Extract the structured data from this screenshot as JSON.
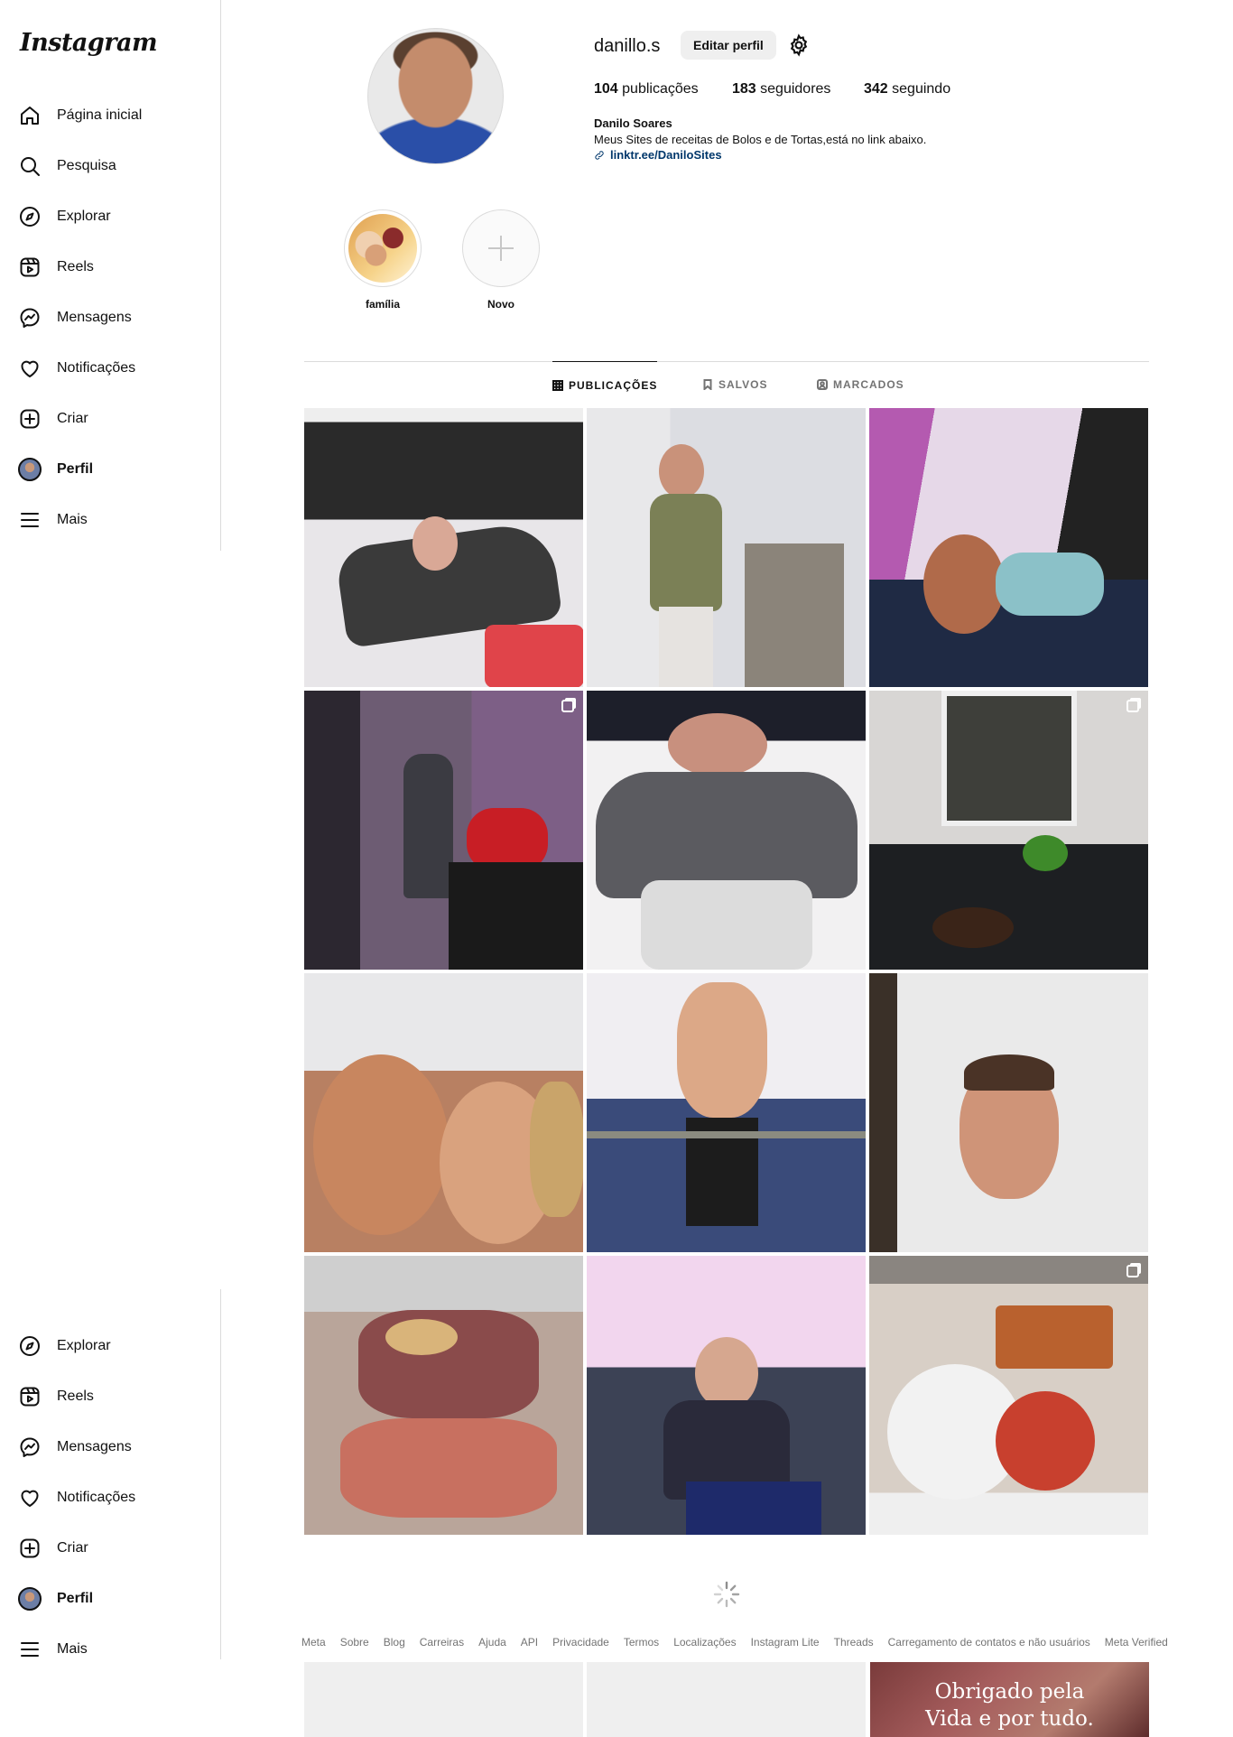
{
  "brand": {
    "logo_text": "Instagram"
  },
  "sidebar_top": {
    "items": [
      {
        "label": "Página inicial",
        "icon": "home-icon"
      },
      {
        "label": "Pesquisa",
        "icon": "search-icon"
      },
      {
        "label": "Explorar",
        "icon": "compass-icon"
      },
      {
        "label": "Reels",
        "icon": "reels-icon"
      },
      {
        "label": "Mensagens",
        "icon": "messenger-icon"
      },
      {
        "label": "Notificações",
        "icon": "heart-icon"
      },
      {
        "label": "Criar",
        "icon": "plus-square-icon"
      },
      {
        "label": "Perfil",
        "icon": "avatar"
      },
      {
        "label": "Mais",
        "icon": "menu-icon"
      }
    ]
  },
  "sidebar_bottom": {
    "items": [
      {
        "label": "Explorar",
        "icon": "compass-icon"
      },
      {
        "label": "Reels",
        "icon": "reels-icon"
      },
      {
        "label": "Mensagens",
        "icon": "messenger-icon"
      },
      {
        "label": "Notificações",
        "icon": "heart-icon"
      },
      {
        "label": "Criar",
        "icon": "plus-square-icon"
      },
      {
        "label": "Perfil",
        "icon": "avatar"
      },
      {
        "label": "Mais",
        "icon": "menu-icon"
      }
    ]
  },
  "profile": {
    "username": "danillo.s",
    "edit_label": "Editar perfil",
    "stats": {
      "posts_count": "104",
      "posts_label": "publicações",
      "followers_count": "183",
      "followers_label": "seguidores",
      "following_count": "342",
      "following_label": "seguindo"
    },
    "full_name": "Danilo Soares",
    "bio": "Meus Sites de receitas de Bolos e de Tortas,está no link abaixo.",
    "link": "linktr.ee/DaniloSites"
  },
  "highlights": [
    {
      "label": "família"
    },
    {
      "label": "Novo"
    }
  ],
  "tabs": [
    {
      "label": "PUBLICAÇÕES",
      "icon": "grid-icon",
      "active": true
    },
    {
      "label": "SALVOS",
      "icon": "bookmark-icon",
      "active": false
    },
    {
      "label": "MARCADOS",
      "icon": "tagged-icon",
      "active": false
    }
  ],
  "posts": [
    {
      "scene": "man lying on bed",
      "multi": false
    },
    {
      "scene": "woman standing in kitchen",
      "multi": false
    },
    {
      "scene": "selfie on couch",
      "multi": false
    },
    {
      "scene": "woman at stove",
      "multi": true
    },
    {
      "scene": "man lying down grey shirt",
      "multi": false
    },
    {
      "scene": "table with cake and drinks",
      "multi": true
    },
    {
      "scene": "selfie with woman",
      "multi": false
    },
    {
      "scene": "mirror selfie",
      "multi": false
    },
    {
      "scene": "man portrait",
      "multi": false
    },
    {
      "scene": "barbecue grill",
      "multi": false
    },
    {
      "scene": "older man on sofa",
      "multi": false
    },
    {
      "scene": "table with cake and pizza",
      "multi": true
    }
  ],
  "footer": {
    "links": [
      "Meta",
      "Sobre",
      "Blog",
      "Carreiras",
      "Ajuda",
      "API",
      "Privacidade",
      "Termos",
      "Localizações",
      "Instagram Lite",
      "Threads",
      "Carregamento de contatos e não usuários",
      "Meta Verified"
    ]
  },
  "partial_post": {
    "line1": "Obrigado pela",
    "line2": "Vida e por tudo."
  },
  "colors": {
    "link": "#00376b",
    "text": "#262626",
    "muted": "#737373",
    "border": "#dbdbdb"
  }
}
